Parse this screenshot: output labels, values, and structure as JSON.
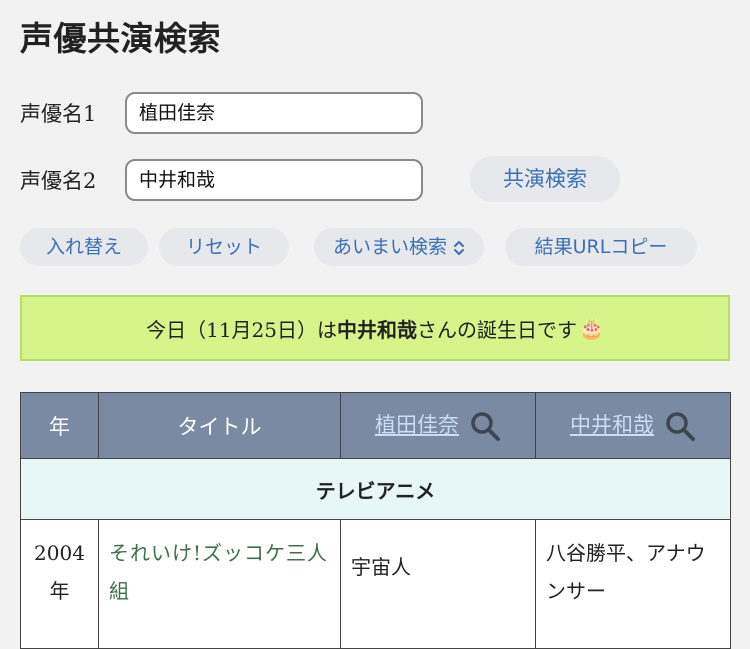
{
  "page": {
    "title": "声優共演検索"
  },
  "form": {
    "label1": "声優名1",
    "value1": "植田佳奈",
    "label2": "声優名2",
    "value2": "中井和哉",
    "search_button": "共演検索"
  },
  "actions": {
    "swap": "入れ替え",
    "reset": "リセット",
    "fuzzy": "あいまい検索",
    "copy_url": "結果URLコピー"
  },
  "banner": {
    "prefix": "今日（11月25日）は ",
    "name": "中井和哉",
    "suffix": "さんの誕生日です",
    "emoji": "🎂"
  },
  "table": {
    "headers": {
      "year": "年",
      "title": "タイトル",
      "actor1": "植田佳奈",
      "actor2": "中井和哉"
    },
    "section": "テレビアニメ",
    "rows": [
      {
        "year": "2004年",
        "title": "それいけ!ズッコケ三人組",
        "role1": "宇宙人",
        "role2": "八谷勝平、アナウンサー"
      }
    ]
  },
  "colors": {
    "header_bg": "#7a8aa2",
    "banner_bg": "#d6f48a",
    "section_bg": "#e7f6f6",
    "pill_text": "#3d6fb6"
  }
}
